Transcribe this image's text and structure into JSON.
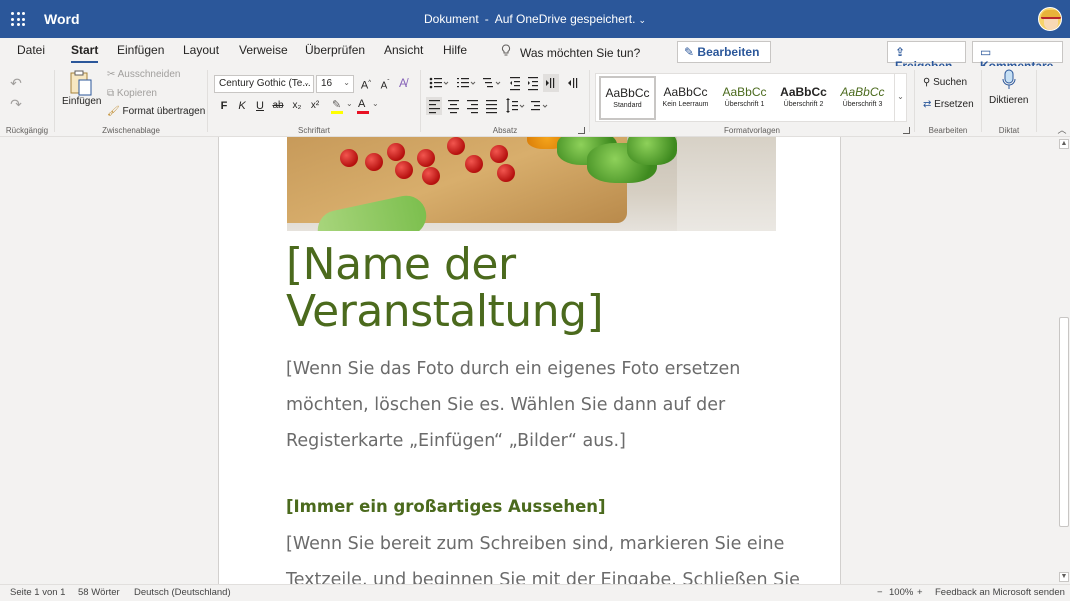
{
  "titlebar": {
    "app_name": "Word",
    "doc_name": "Dokument",
    "separator": "-",
    "save_status": "Auf OneDrive gespeichert.",
    "chevron": "⌄"
  },
  "tabs": [
    {
      "label": "Datei"
    },
    {
      "label": "Start"
    },
    {
      "label": "Einfügen"
    },
    {
      "label": "Layout"
    },
    {
      "label": "Verweise"
    },
    {
      "label": "Überprüfen"
    },
    {
      "label": "Ansicht"
    },
    {
      "label": "Hilfe"
    }
  ],
  "tell_me": "Was möchten Sie tun?",
  "mode_button": "Bearbeiten",
  "share_button": "Freigeben",
  "comments_button": "Kommentare",
  "ribbon": {
    "undo_group_label": "Rückgängig",
    "clipboard": {
      "paste_label": "Einfügen",
      "cut_label": "Ausschneiden",
      "copy_label": "Kopieren",
      "format_painter_label": "Format übertragen",
      "group_label": "Zwischenablage"
    },
    "font": {
      "font_name": "Century Gothic (Te...",
      "font_size": "16",
      "bold": "F",
      "italic": "K",
      "underline": "U",
      "strike": "ab",
      "subscript": "x₂",
      "superscript": "x²",
      "group_label": "Schriftart"
    },
    "paragraph": {
      "group_label": "Absatz"
    },
    "styles": {
      "items": [
        {
          "sample": "AaBbCc",
          "name": "Standard"
        },
        {
          "sample": "AaBbCc",
          "name": "Kein Leerraum"
        },
        {
          "sample": "AaBbCc",
          "name": "Überschrift 1"
        },
        {
          "sample": "AaBbCc",
          "name": "Überschrift 2"
        },
        {
          "sample": "AaBbCc",
          "name": "Überschrift 3"
        }
      ],
      "group_label": "Formatvorlagen"
    },
    "editing": {
      "find_label": "Suchen",
      "replace_label": "Ersetzen",
      "group_label": "Bearbeiten"
    },
    "dictate": {
      "label": "Diktieren",
      "group_label": "Diktat"
    }
  },
  "document": {
    "title_line1": "[Name der",
    "title_line2": "Veranstaltung]",
    "para1_line1": "[Wenn Sie das Foto durch ein eigenes Foto ersetzen",
    "para1_line2": "möchten, löschen Sie es. Wählen Sie dann auf der",
    "para1_line3": "Registerkarte „Einfügen“ „Bilder“ aus.]",
    "heading": "[Immer ein großartiges Aussehen]",
    "para2_line1": "[Wenn Sie bereit zum Schreiben sind, markieren Sie eine",
    "para2_line2": "Textzeile, und beginnen Sie mit der Eingabe. Schließen Sie"
  },
  "statusbar": {
    "page": "Seite 1 von 1",
    "words": "58 Wörter",
    "language": "Deutsch (Deutschland)",
    "zoom_minus": "−",
    "zoom": "100%",
    "zoom_plus": "+",
    "feedback": "Feedback an Microsoft senden"
  },
  "colors": {
    "title_bar": "#2b579a",
    "doc_title": "#4b6a1d",
    "body_text": "#6b6b6b"
  }
}
